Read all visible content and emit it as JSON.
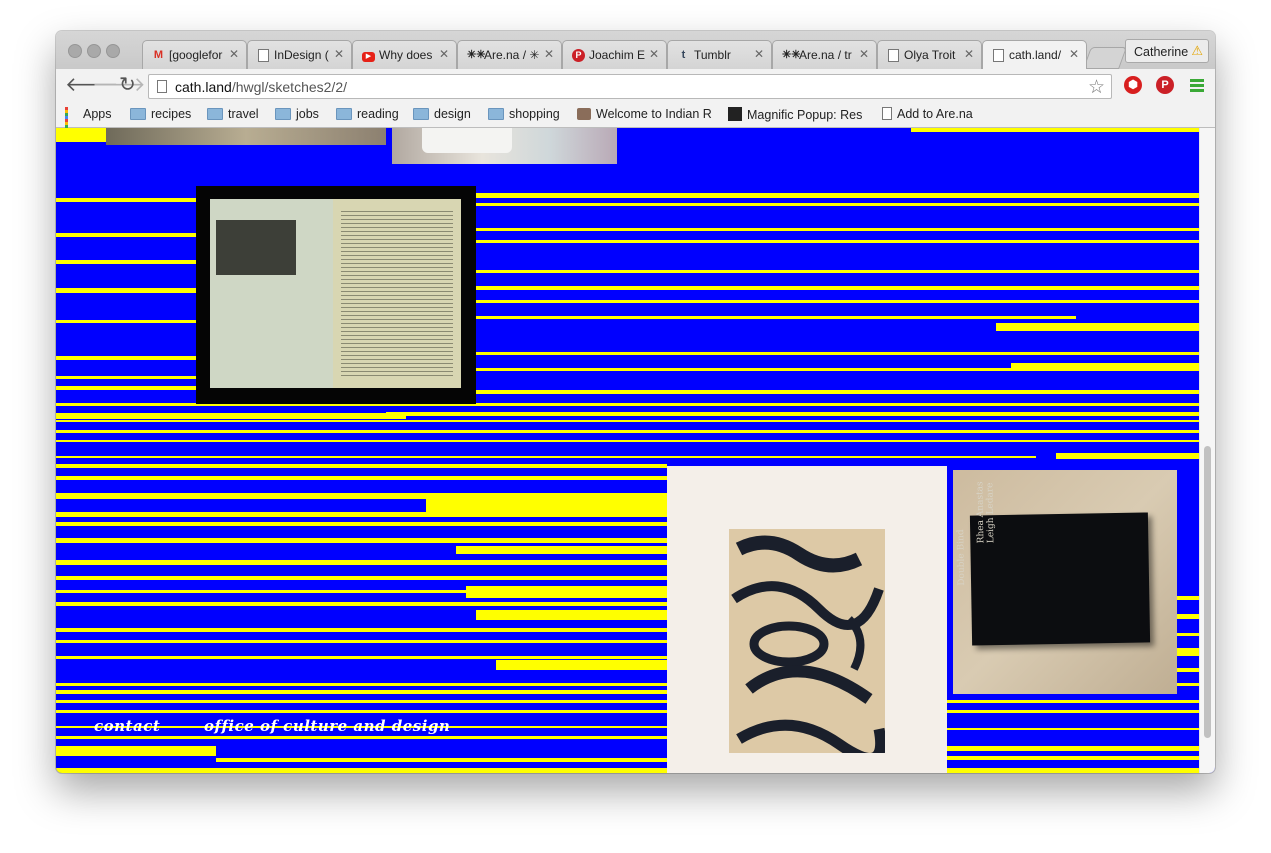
{
  "browser": {
    "tabs": [
      {
        "title": "[googlefor",
        "icon": "gmail-icon"
      },
      {
        "title": "InDesign (",
        "icon": "page-icon"
      },
      {
        "title": "Why does",
        "icon": "youtube-icon"
      },
      {
        "title": "Are.na / ✳",
        "icon": "arena-icon"
      },
      {
        "title": "Joachim E",
        "icon": "pinterest-icon"
      },
      {
        "title": "Tumblr",
        "icon": "tumblr-icon"
      },
      {
        "title": "Are.na / tr",
        "icon": "arena-icon"
      },
      {
        "title": "Olya Troit",
        "icon": "page-icon"
      },
      {
        "title": "cath.land/",
        "icon": "page-icon",
        "active": true
      }
    ],
    "profile_name": "Catherine",
    "url_host": "cath.land",
    "url_path": "/hwgl/sketches2/2/",
    "bookmarks": [
      {
        "label": "Apps",
        "icon": "apps-icon"
      },
      {
        "label": "recipes",
        "icon": "folder-icon"
      },
      {
        "label": "travel",
        "icon": "folder-icon"
      },
      {
        "label": "jobs",
        "icon": "folder-icon"
      },
      {
        "label": "reading",
        "icon": "folder-icon"
      },
      {
        "label": "design",
        "icon": "folder-icon"
      },
      {
        "label": "shopping",
        "icon": "folder-icon"
      },
      {
        "label": "Welcome to Indian R",
        "icon": "site-icon"
      },
      {
        "label": "Magnific Popup: Res",
        "icon": "site-icon"
      },
      {
        "label": "Add to Are.na",
        "icon": "page-icon"
      }
    ]
  },
  "page": {
    "colors": {
      "background": "#0000ff",
      "stripes": "#ffff00",
      "text": "#ffffff"
    },
    "footer": {
      "contact": "contact",
      "office": "office of culture and design"
    },
    "images": [
      {
        "name": "open-book-photo"
      },
      {
        "name": "abstract-book-cover-photo"
      },
      {
        "name": "double-bind-book-photo",
        "spine_text_1": "Double Bind",
        "spine_text_2": "Rhea Anastas",
        "spine_text_3": "Leigh Ledare"
      }
    ]
  }
}
